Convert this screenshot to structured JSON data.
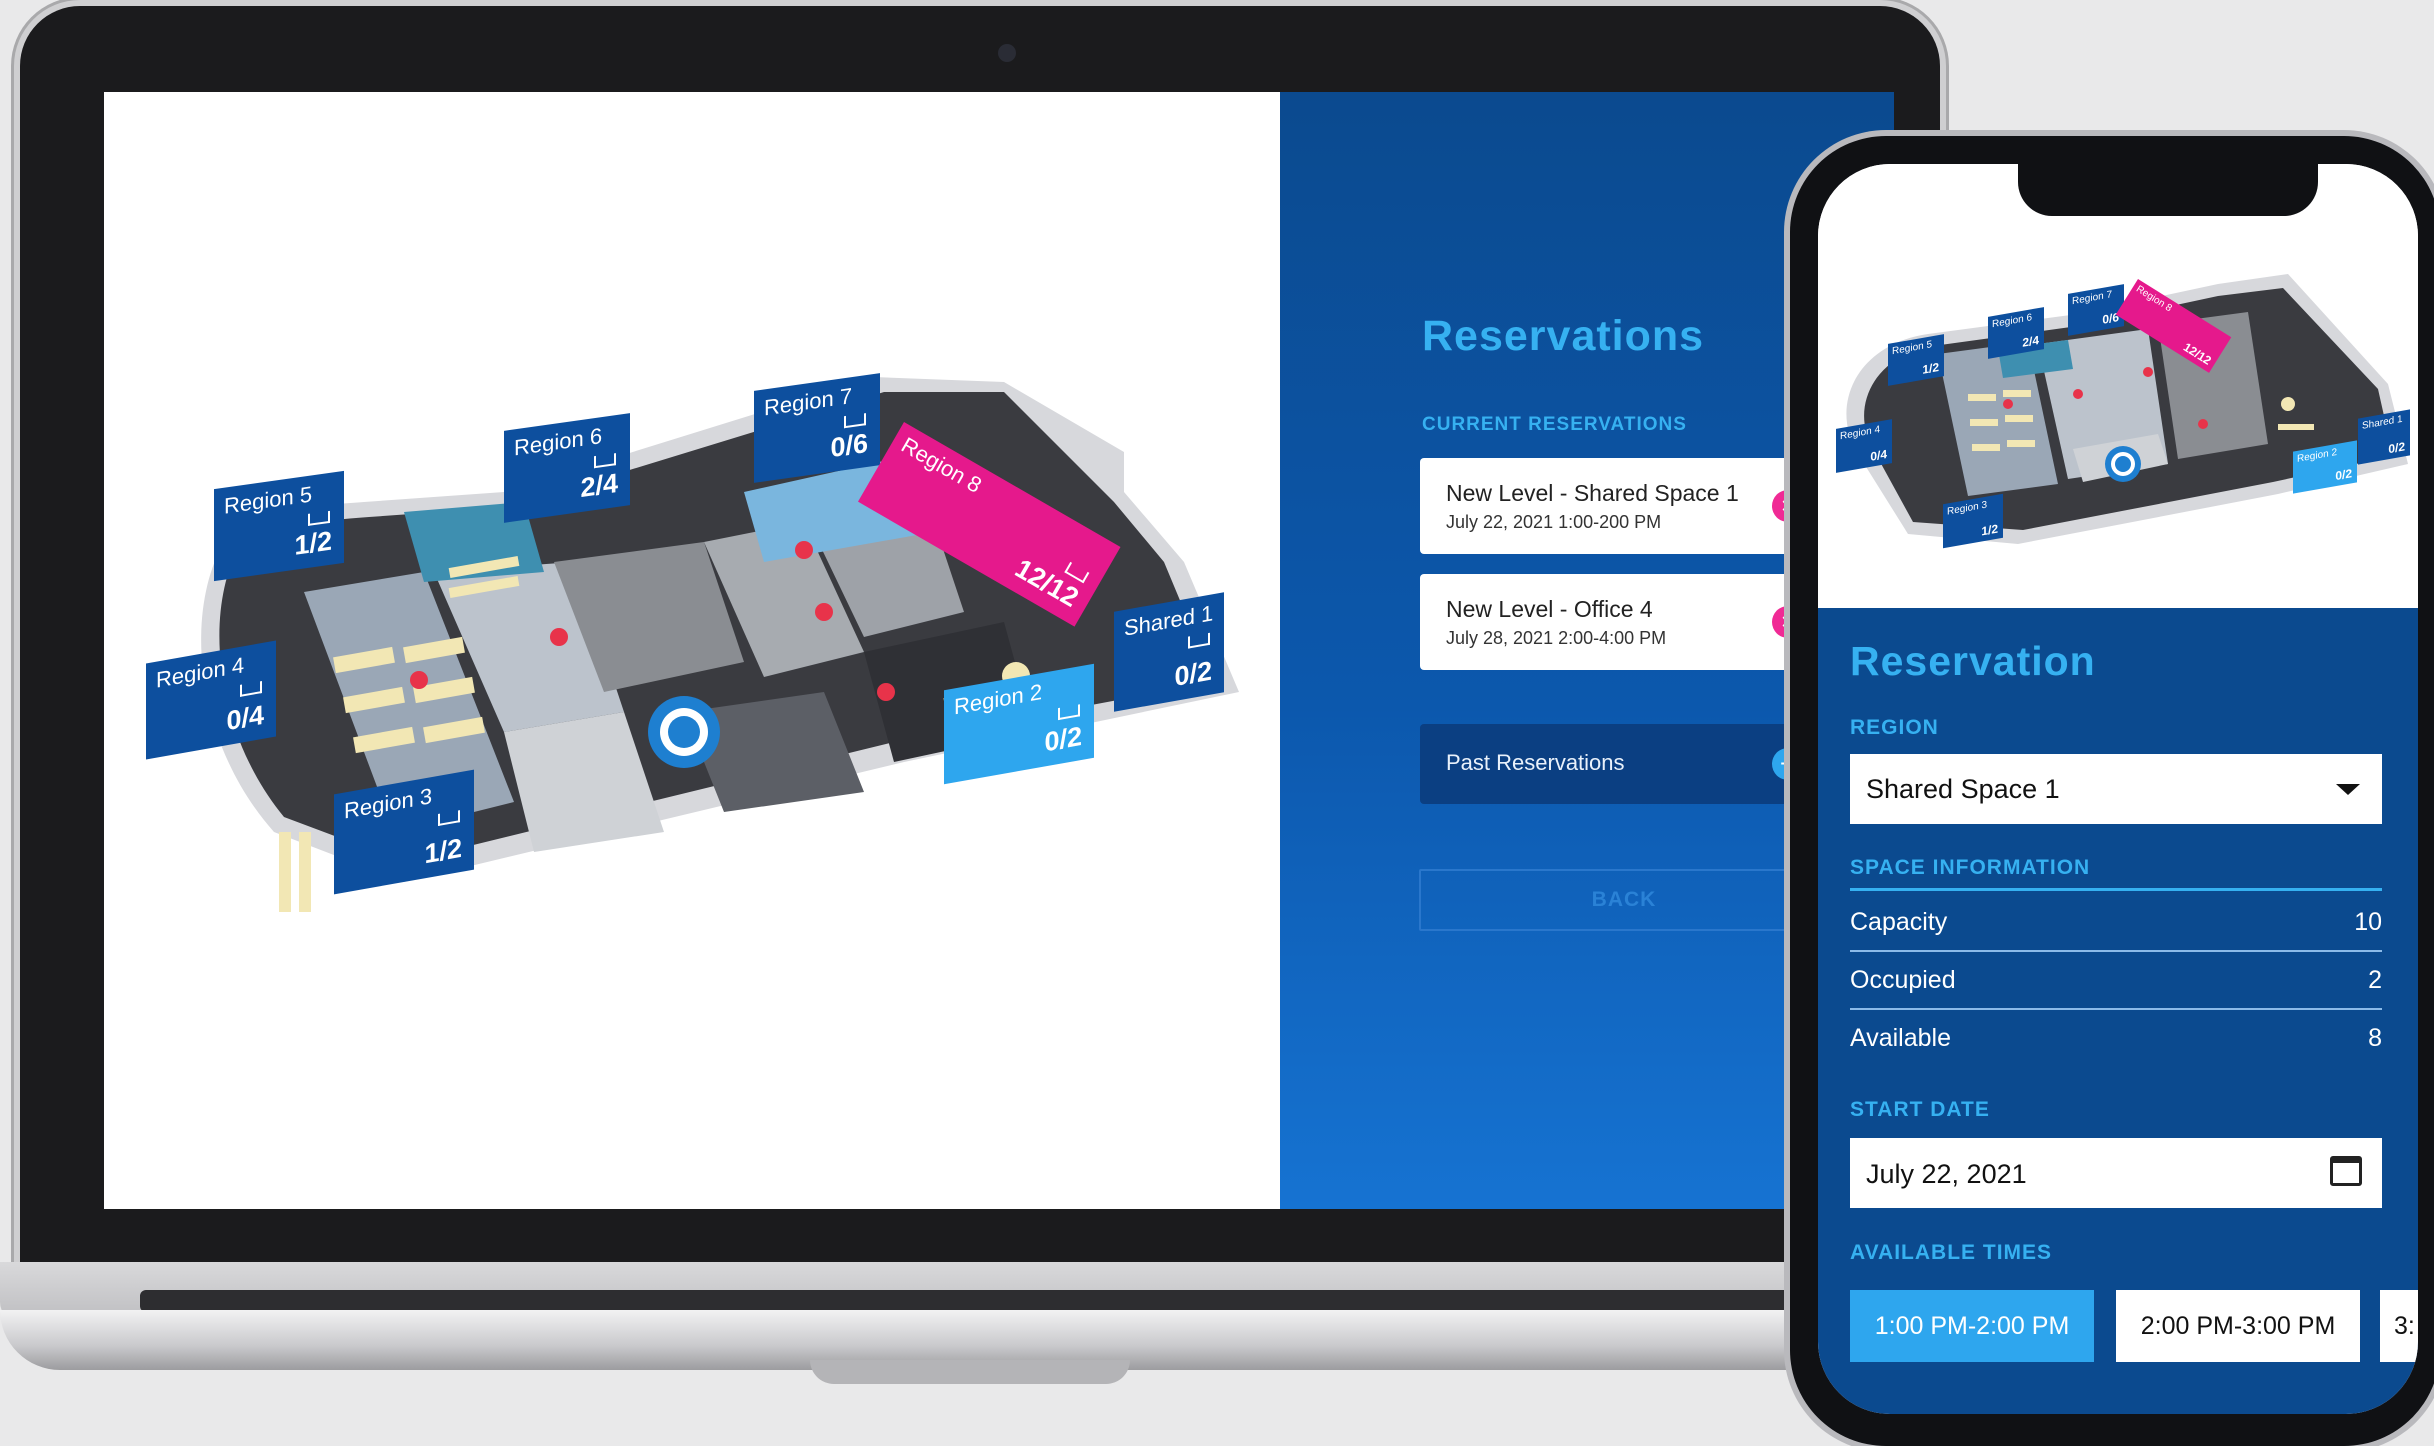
{
  "laptop": {
    "map": {
      "regions": [
        {
          "name": "Region 5",
          "count": "1/2"
        },
        {
          "name": "Region 6",
          "count": "2/4"
        },
        {
          "name": "Region 7",
          "count": "0/6"
        },
        {
          "name": "Region 8",
          "count": "12/12"
        },
        {
          "name": "Shared 1",
          "count": "0/2"
        },
        {
          "name": "Region 2",
          "count": "0/2"
        },
        {
          "name": "Region 3",
          "count": "1/2"
        },
        {
          "name": "Region 4",
          "count": "0/4"
        }
      ]
    },
    "reservations": {
      "title": "Reservations",
      "current_label": "CURRENT RESERVATIONS",
      "items": [
        {
          "name": "New Level - Shared Space 1",
          "date": "July 22, 2021  1:00-200 PM"
        },
        {
          "name": "New Level - Office 4",
          "date": "July 28, 2021  2:00-4:00 PM"
        }
      ],
      "past_label": "Past Reservations",
      "back_label": "BACK"
    }
  },
  "phone": {
    "title": "Reservation",
    "region_label": "REGION",
    "region_value": "Shared Space 1",
    "space_info_label": "SPACE INFORMATION",
    "space_info": [
      {
        "key": "Capacity",
        "value": "10"
      },
      {
        "key": "Occupied",
        "value": "2"
      },
      {
        "key": "Available",
        "value": "8"
      }
    ],
    "start_date_label": "START DATE",
    "start_date_value": "July 22, 2021",
    "available_times_label": "AVAILABLE TIMES",
    "times": [
      "1:00 PM-2:00 PM",
      "2:00 PM-3:00 PM",
      "3:"
    ],
    "map_regions": [
      {
        "name": "Region 5",
        "count": "1/2"
      },
      {
        "name": "Region 6",
        "count": "2/4"
      },
      {
        "name": "Region 7",
        "count": "0/6"
      },
      {
        "name": "Region 8",
        "count": "12/12"
      },
      {
        "name": "Shared 1",
        "count": "0/2"
      },
      {
        "name": "Region 2",
        "count": "0/2"
      },
      {
        "name": "Region 3",
        "count": "1/2"
      },
      {
        "name": "Region 4",
        "count": "0/4"
      }
    ]
  },
  "colors": {
    "panel_blue": "#0b4a8f",
    "accent_cyan": "#36b1f1",
    "region_blue": "#0d4f9e",
    "region_pink": "#e5198c",
    "cancel_pink": "#f02a95",
    "selected_time": "#2ea6ee"
  }
}
